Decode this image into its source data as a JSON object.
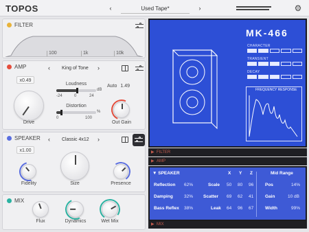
{
  "header": {
    "logo": "TOPOS",
    "preset_prev": "‹",
    "preset_name": "Used Tape*",
    "preset_next": "›"
  },
  "filter": {
    "title": "FILTER",
    "color": "#e8b33a",
    "freq_labels": [
      "100",
      "1k",
      "10k"
    ]
  },
  "amp": {
    "title": "AMP",
    "color": "#e54d3c",
    "multiplier": "x0.49",
    "model_prev": "‹",
    "model_name": "King of Tone",
    "model_next": "›",
    "loudness_label": "Loudness",
    "loudness_unit": "dB",
    "loudness_scale": [
      "-24",
      "0",
      "24"
    ],
    "distortion_label": "Distortion",
    "distortion_unit": "%",
    "distortion_scale": [
      "0",
      "100"
    ],
    "auto_label": "Auto",
    "auto_value": "1.49",
    "drive_label": "Drive",
    "out_gain_label": "Out Gain"
  },
  "speaker": {
    "title": "SPEAKER",
    "color": "#5a6ee0",
    "multiplier": "x1.00",
    "model_prev": "‹",
    "model_name": "Classic 4x12",
    "model_next": "›",
    "fidelity_label": "Fidelity",
    "size_label": "Size",
    "presence_label": "Presence"
  },
  "mix": {
    "title": "MIX",
    "color": "#2bb3a2",
    "flux_label": "Flux",
    "dynamics_label": "Dynamics",
    "wetmix_label": "Wet Mix"
  },
  "viz": {
    "model": "MK-466",
    "character_label": "CHARACTER",
    "character_level": 0.4,
    "transient_label": "TRANSIENT",
    "transient_level": 0.6,
    "decay_label": "DECAY",
    "decay_level": 0.6,
    "freq_response_label": "FREQUENCY RESPONSE"
  },
  "sections": {
    "filter": "FILTER",
    "amp": "AMP",
    "speaker": "SPEAKER",
    "mix": "MIX"
  },
  "speaker_table": {
    "col_x": "X",
    "col_y": "Y",
    "col_z": "Z",
    "mid_range": "Mid Range",
    "reflection": "Reflection",
    "reflection_val": "62%",
    "damping": "Damping",
    "damping_val": "32%",
    "bass_reflex": "Bass Reflex",
    "bass_reflex_val": "38%",
    "scale": "Scale",
    "scale_x": "50",
    "scale_y": "80",
    "scale_z": "96",
    "scatter": "Scatter",
    "scatter_x": "69",
    "scatter_y": "62",
    "scatter_z": "41",
    "leak": "Leak",
    "leak_x": "64",
    "leak_y": "96",
    "leak_z": "67",
    "pos": "Pos",
    "pos_val": "14%",
    "gain": "Gain",
    "gain_val": "10 dB",
    "width": "Width",
    "width_val": "99%"
  },
  "colors": {
    "accent_blue": "#2d4fd6",
    "panel_bg": "#f0f0f2",
    "dark": "#1f1f23"
  }
}
